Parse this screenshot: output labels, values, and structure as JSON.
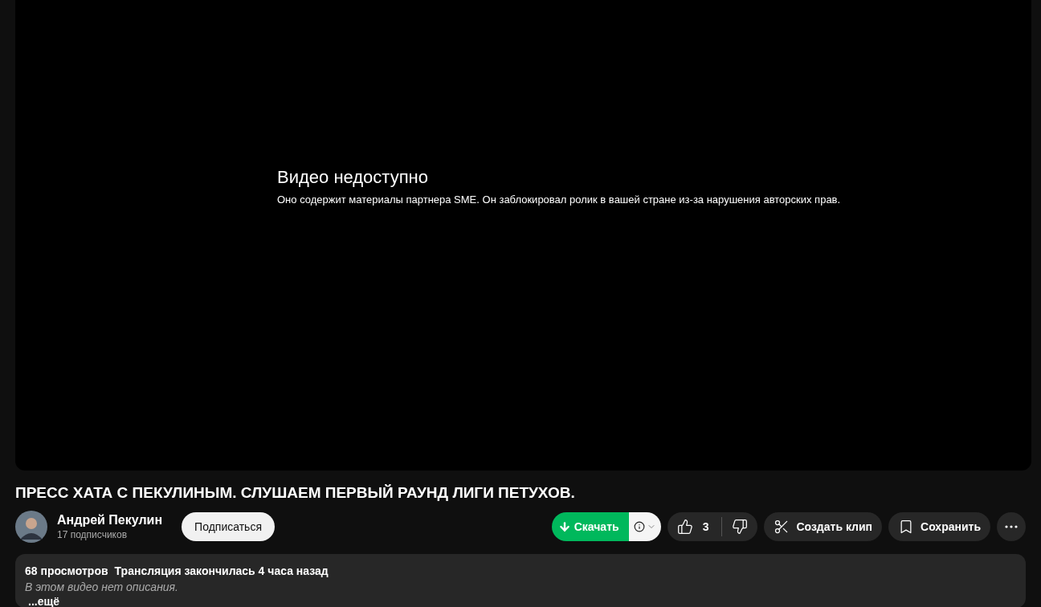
{
  "player": {
    "error_title": "Видео недоступно",
    "error_message": "Оно содержит материалы партнера SME. Он заблокировал ролик в вашей стране из-за нарушения авторских прав."
  },
  "video_title": "ПРЕСС ХАТА С ПЕКУЛИНЫМ. СЛУШАЕМ ПЕРВЫЙ РАУНД ЛИГИ ПЕТУХОВ.",
  "channel": {
    "name": "Андрей Пекулин",
    "subscribers": "17 подписчиков",
    "subscribe_label": "Подписаться"
  },
  "actions": {
    "download_label": "Скачать",
    "likes": "3",
    "clip_label": "Создать клип",
    "save_label": "Сохранить"
  },
  "description": {
    "views": "68 просмотров",
    "stream_info": "Трансляция закончилась 4 часа назад",
    "text": "В этом видео нет описания.",
    "more_label": "...ещё"
  }
}
